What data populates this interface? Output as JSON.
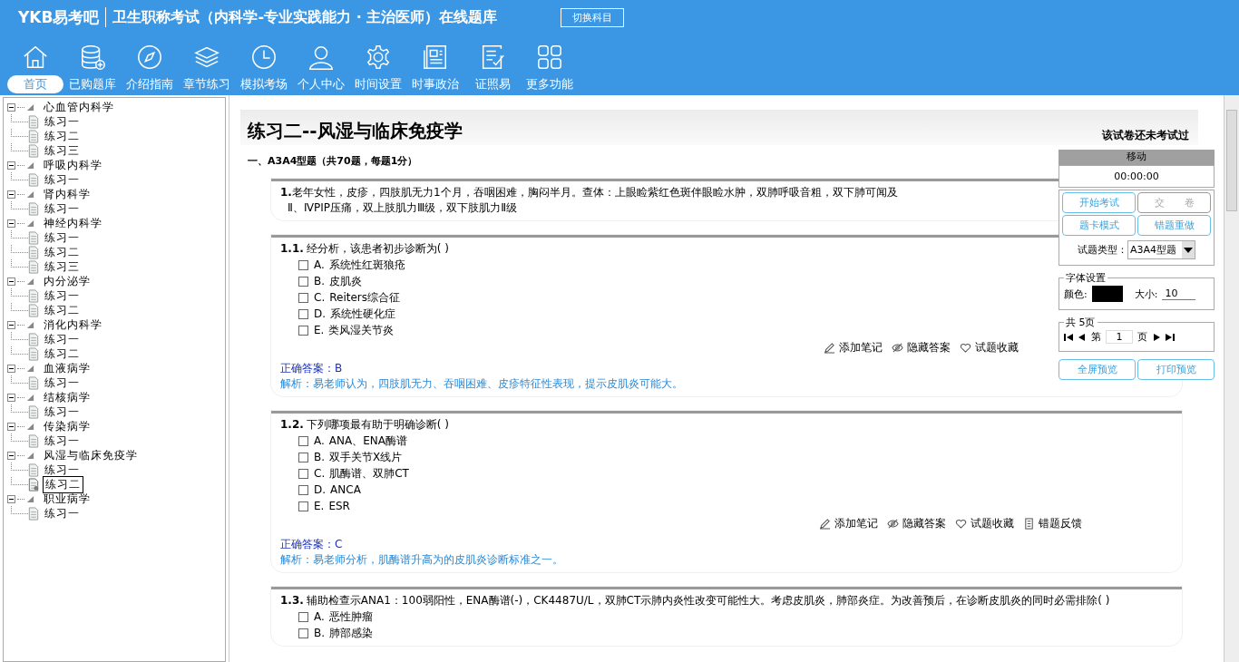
{
  "header": {
    "logo": "YKB易考吧",
    "title": "卫生职称考试（内科学-专业实践能力 · 主治医师）在线题库",
    "switch_button": "切换科目"
  },
  "nav": [
    {
      "kind": "home",
      "label": "首页",
      "selected": true
    },
    {
      "kind": "database",
      "label": "已购题库",
      "selected": false
    },
    {
      "kind": "compass",
      "label": "介绍指南",
      "selected": false
    },
    {
      "kind": "layers",
      "label": "章节练习",
      "selected": false
    },
    {
      "kind": "clock",
      "label": "模拟考场",
      "selected": false
    },
    {
      "kind": "person",
      "label": "个人中心",
      "selected": false
    },
    {
      "kind": "gear",
      "label": "时间设置",
      "selected": false
    },
    {
      "kind": "news",
      "label": "时事政治",
      "selected": false
    },
    {
      "kind": "checklist",
      "label": "证照易",
      "selected": false
    },
    {
      "kind": "grid",
      "label": "更多功能",
      "selected": false
    }
  ],
  "tree": [
    {
      "label": "心血管内科学",
      "expanded": true,
      "children": [
        {
          "label": "练习一",
          "selected": false
        },
        {
          "label": "练习二",
          "selected": false
        },
        {
          "label": "练习三",
          "selected": false
        }
      ]
    },
    {
      "label": "呼吸内科学",
      "expanded": true,
      "children": [
        {
          "label": "练习一",
          "selected": false
        }
      ]
    },
    {
      "label": "肾内科学",
      "expanded": true,
      "children": [
        {
          "label": "练习一",
          "selected": false
        }
      ]
    },
    {
      "label": "神经内科学",
      "expanded": true,
      "children": [
        {
          "label": "练习一",
          "selected": false
        },
        {
          "label": "练习二",
          "selected": false
        },
        {
          "label": "练习三",
          "selected": false
        }
      ]
    },
    {
      "label": "内分泌学",
      "expanded": true,
      "children": [
        {
          "label": "练习一",
          "selected": false
        },
        {
          "label": "练习二",
          "selected": false
        }
      ]
    },
    {
      "label": "消化内科学",
      "expanded": true,
      "children": [
        {
          "label": "练习一",
          "selected": false
        },
        {
          "label": "练习二",
          "selected": false
        }
      ]
    },
    {
      "label": "血液病学",
      "expanded": true,
      "children": [
        {
          "label": "练习一",
          "selected": false
        }
      ]
    },
    {
      "label": "结核病学",
      "expanded": true,
      "children": [
        {
          "label": "练习一",
          "selected": false
        }
      ]
    },
    {
      "label": "传染病学",
      "expanded": true,
      "children": [
        {
          "label": "练习一",
          "selected": false
        }
      ]
    },
    {
      "label": "风湿与临床免疫学",
      "expanded": true,
      "children": [
        {
          "label": "练习一",
          "selected": false
        },
        {
          "label": "练习二",
          "selected": true
        }
      ]
    },
    {
      "label": "职业病学",
      "expanded": true,
      "children": [
        {
          "label": "练习一",
          "selected": false
        }
      ]
    }
  ],
  "paper": {
    "title": "练习二--风湿与临床免疫学",
    "status": "该试卷还未考试过",
    "section": "一、A3A4型题（共70题，每题1分）"
  },
  "items": [
    {
      "kind": "stem",
      "number": "1.",
      "text": "老年女性，皮疹，四肢肌无力1个月，吞咽困难，胸闷半月。查体：上眼睑紫红色斑伴眼睑水肿，双肺呼吸音粗，双下肺可闻及",
      "text2": "Ⅱ、ⅣPIP压痛，双上肢肌力Ⅲ级，双下肢肌力Ⅱ级"
    },
    {
      "kind": "question",
      "number": "1.1.",
      "text": "经分析，该患者初步诊断为( )",
      "options": [
        {
          "label": "A.",
          "text": "系统性红斑狼疮",
          "checked": false
        },
        {
          "label": "B.",
          "text": "皮肌炎",
          "checked": false
        },
        {
          "label": "C.",
          "text": "Reiters综合征",
          "checked": false
        },
        {
          "label": "D.",
          "text": "系统性硬化症",
          "checked": false
        },
        {
          "label": "E.",
          "text": "类风湿关节炎",
          "checked": false
        }
      ],
      "actions": [
        {
          "kind": "pencil",
          "label": "添加笔记"
        },
        {
          "kind": "eye",
          "label": "隐藏答案"
        },
        {
          "kind": "heart",
          "label": "试题收藏"
        }
      ],
      "answer": "正确答案：B",
      "analysis": "解析：易老师认为，四肢肌无力、吞咽困难、皮疹特征性表现，提示皮肌炎可能大。"
    },
    {
      "kind": "question",
      "number": "1.2.",
      "text": "下列哪项最有助于明确诊断( )",
      "options": [
        {
          "label": "A.",
          "text": "ANA、ENA酶谱",
          "checked": false
        },
        {
          "label": "B.",
          "text": "双手关节X线片",
          "checked": false
        },
        {
          "label": "C.",
          "text": "肌酶谱、双肺CT",
          "checked": false
        },
        {
          "label": "D.",
          "text": "ANCA",
          "checked": false
        },
        {
          "label": "E.",
          "text": "ESR",
          "checked": false
        }
      ],
      "actions": [
        {
          "kind": "pencil",
          "label": "添加笔记"
        },
        {
          "kind": "eye",
          "label": "隐藏答案"
        },
        {
          "kind": "heart",
          "label": "试题收藏"
        },
        {
          "kind": "report",
          "label": "错题反馈"
        }
      ],
      "answer": "正确答案：C",
      "analysis": "解析：易老师分析，肌酶谱升高为的皮肌炎诊断标准之一。"
    },
    {
      "kind": "question",
      "number": "1.3.",
      "text": "辅助检查示ANA1：100弱阳性，ENA酶谱(-)，CK4487U/L，双肺CT示肺内炎性改变可能性大。考虑皮肌炎，肺部炎症。为改善预后，在诊断皮肌炎的同时必需排除( )",
      "options": [
        {
          "label": "A.",
          "text": "恶性肿瘤",
          "checked": false
        },
        {
          "label": "B.",
          "text": "肺部感染",
          "checked": false
        }
      ]
    }
  ],
  "panel": {
    "move_label": "移动",
    "timer": "00:00:00",
    "buttons": [
      {
        "label": "开始考试",
        "disabled": false
      },
      {
        "label": "交　　卷",
        "disabled": true
      },
      {
        "label": "题卡模式",
        "disabled": false
      },
      {
        "label": "错题重做",
        "disabled": false
      }
    ],
    "type_label": "试题类型：",
    "type_value": "A3A4型题",
    "font_legend": "字体设置",
    "color_label": "颜色:",
    "color": "#000000",
    "size_label": "大小:",
    "size_value": "10",
    "pager_legend": "共 5页",
    "page_prefix": "第",
    "page_value": "1",
    "page_suffix": "页",
    "bottom_buttons": [
      "全屏预览",
      "打印预览"
    ]
  }
}
